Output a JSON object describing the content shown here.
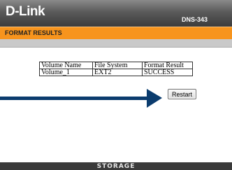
{
  "header": {
    "logo": "D-Link",
    "model": "DNS-343"
  },
  "page": {
    "title": "FORMAT RESULTS"
  },
  "results_table": {
    "columns": [
      "Volume Name",
      "File System",
      "Format Result"
    ],
    "rows": [
      [
        "Volume_1",
        "EXT2",
        "SUCCESS"
      ]
    ]
  },
  "restart_button": {
    "label": "Restart"
  },
  "footer": {
    "label": "STORAGE"
  },
  "colors": {
    "title_bar": "#f7941d",
    "header": "#3c3c3c",
    "arrow": "#0b3c6e"
  }
}
